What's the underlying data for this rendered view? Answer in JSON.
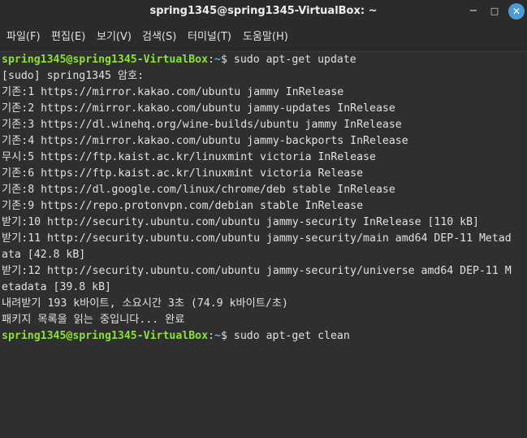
{
  "window": {
    "title": "spring1345@spring1345-VirtualBox: ~",
    "minimize_glyph": "−",
    "maximize_glyph": "□",
    "close_glyph": "✕"
  },
  "menu": [
    "파일(F)",
    "편집(E)",
    "보기(V)",
    "검색(S)",
    "터미널(T)",
    "도움말(H)"
  ],
  "terminal": {
    "prompt_user": "spring1345@spring1345-VirtualBox",
    "prompt_sep": ":",
    "prompt_path": "~",
    "prompt_symbol": "$ ",
    "command1": "sudo apt-get update",
    "output": [
      "[sudo] spring1345 암호:",
      "기존:1 https://mirror.kakao.com/ubuntu jammy InRelease",
      "기존:2 https://mirror.kakao.com/ubuntu jammy-updates InRelease",
      "기존:3 https://dl.winehq.org/wine-builds/ubuntu jammy InRelease",
      "기존:4 https://mirror.kakao.com/ubuntu jammy-backports InRelease",
      "무시:5 https://ftp.kaist.ac.kr/linuxmint victoria InRelease",
      "기존:6 https://ftp.kaist.ac.kr/linuxmint victoria Release",
      "기존:8 https://dl.google.com/linux/chrome/deb stable InRelease",
      "기존:9 https://repo.protonvpn.com/debian stable InRelease",
      "받기:10 http://security.ubuntu.com/ubuntu jammy-security InRelease [110 kB]",
      "받기:11 http://security.ubuntu.com/ubuntu jammy-security/main amd64 DEP-11 Metad",
      "ata [42.8 kB]",
      "받기:12 http://security.ubuntu.com/ubuntu jammy-security/universe amd64 DEP-11 M",
      "etadata [39.8 kB]",
      "내려받기 193 k바이트, 소요시간 3초 (74.9 k바이트/초)",
      "패키지 목록을 읽는 중입니다... 완료"
    ],
    "command2": "sudo apt-get clean"
  },
  "colors": {
    "prompt_user": "#8ae234",
    "prompt_path": "#6fa8dc",
    "text": "#e0e0e0",
    "background": "#2f2f2f",
    "close_button": "#4a9cd6"
  }
}
